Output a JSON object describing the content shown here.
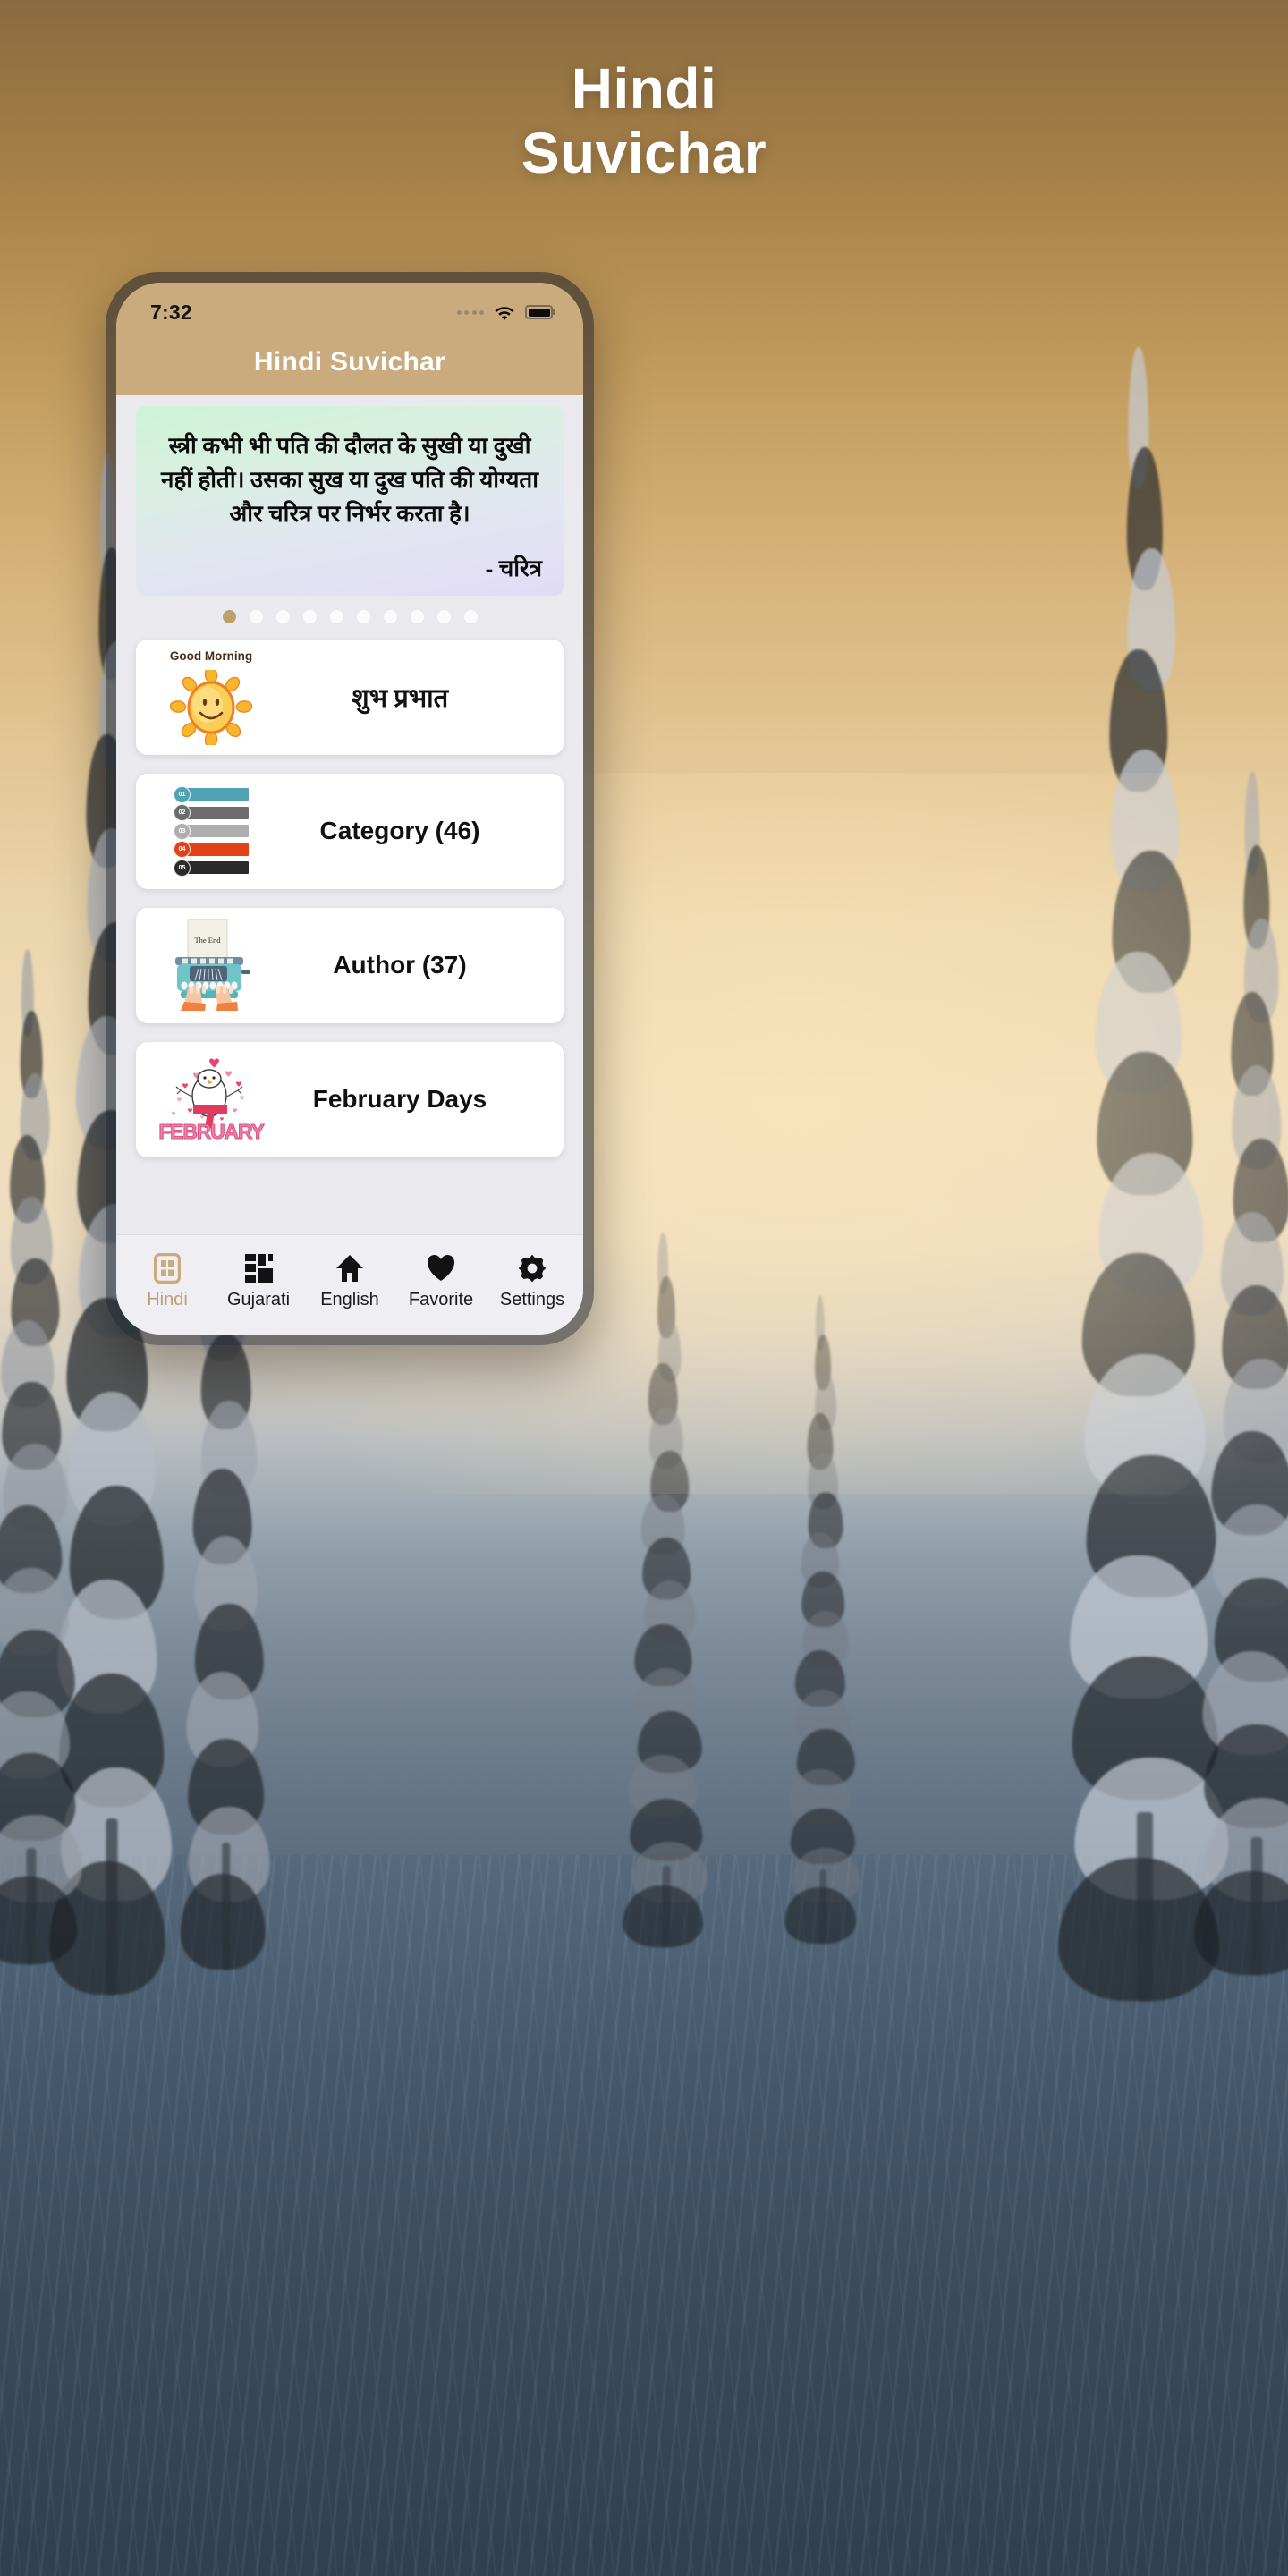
{
  "promo": {
    "headline_line1": "Hindi",
    "headline_line2": "Suvichar"
  },
  "phone": {
    "status_bar": {
      "time": "7:32",
      "signal_icon": "signal-dots-icon",
      "wifi_icon": "wifi-icon",
      "battery_icon": "battery-full-icon"
    },
    "app_bar": {
      "title": "Hindi Suvichar"
    },
    "quote_card": {
      "text": "स्त्री कभी भी पति की दौलत के सुखी या दुखी नहीं होती। उसका सुख या दुख पति की योग्यता और चरित्र पर निर्भर करता है।",
      "author": "- चरित्र",
      "gradient_start": "#cdf4d6",
      "gradient_end": "#e0dbf5"
    },
    "pager": {
      "total": 10,
      "active_index": 0,
      "active_color": "#bda06e",
      "inactive_color": "#fbfbfc"
    },
    "menu_items": [
      {
        "label": "शुभ प्रभात",
        "icon": "good-morning-sun-icon",
        "icon_caption": "Good Morning",
        "script": "devanagari"
      },
      {
        "label": "Category (46)",
        "icon": "category-bars-icon",
        "script": "latin"
      },
      {
        "label": "Author (37)",
        "icon": "typewriter-icon",
        "icon_caption": "The End",
        "script": "latin"
      },
      {
        "label": "February Days",
        "icon": "february-hearts-icon",
        "icon_caption": "FEBRUARY",
        "script": "latin"
      }
    ],
    "category_icon_rows": [
      {
        "number": "01",
        "color": "#4fa3b5"
      },
      {
        "number": "02",
        "color": "#6d6d6d"
      },
      {
        "number": "03",
        "color": "#aeaeae"
      },
      {
        "number": "04",
        "color": "#e2421a"
      },
      {
        "number": "05",
        "color": "#2b2b2b"
      }
    ],
    "bottom_nav": [
      {
        "label": "Hindi",
        "icon": "grid-window-icon",
        "active": true
      },
      {
        "label": "Gujarati",
        "icon": "dashboard-blocks-icon",
        "active": false
      },
      {
        "label": "English",
        "icon": "home-icon",
        "active": false
      },
      {
        "label": "Favorite",
        "icon": "heart-icon",
        "active": false
      },
      {
        "label": "Settings",
        "icon": "gear-icon",
        "active": false
      }
    ],
    "accent_color": "#c9ab7d"
  }
}
